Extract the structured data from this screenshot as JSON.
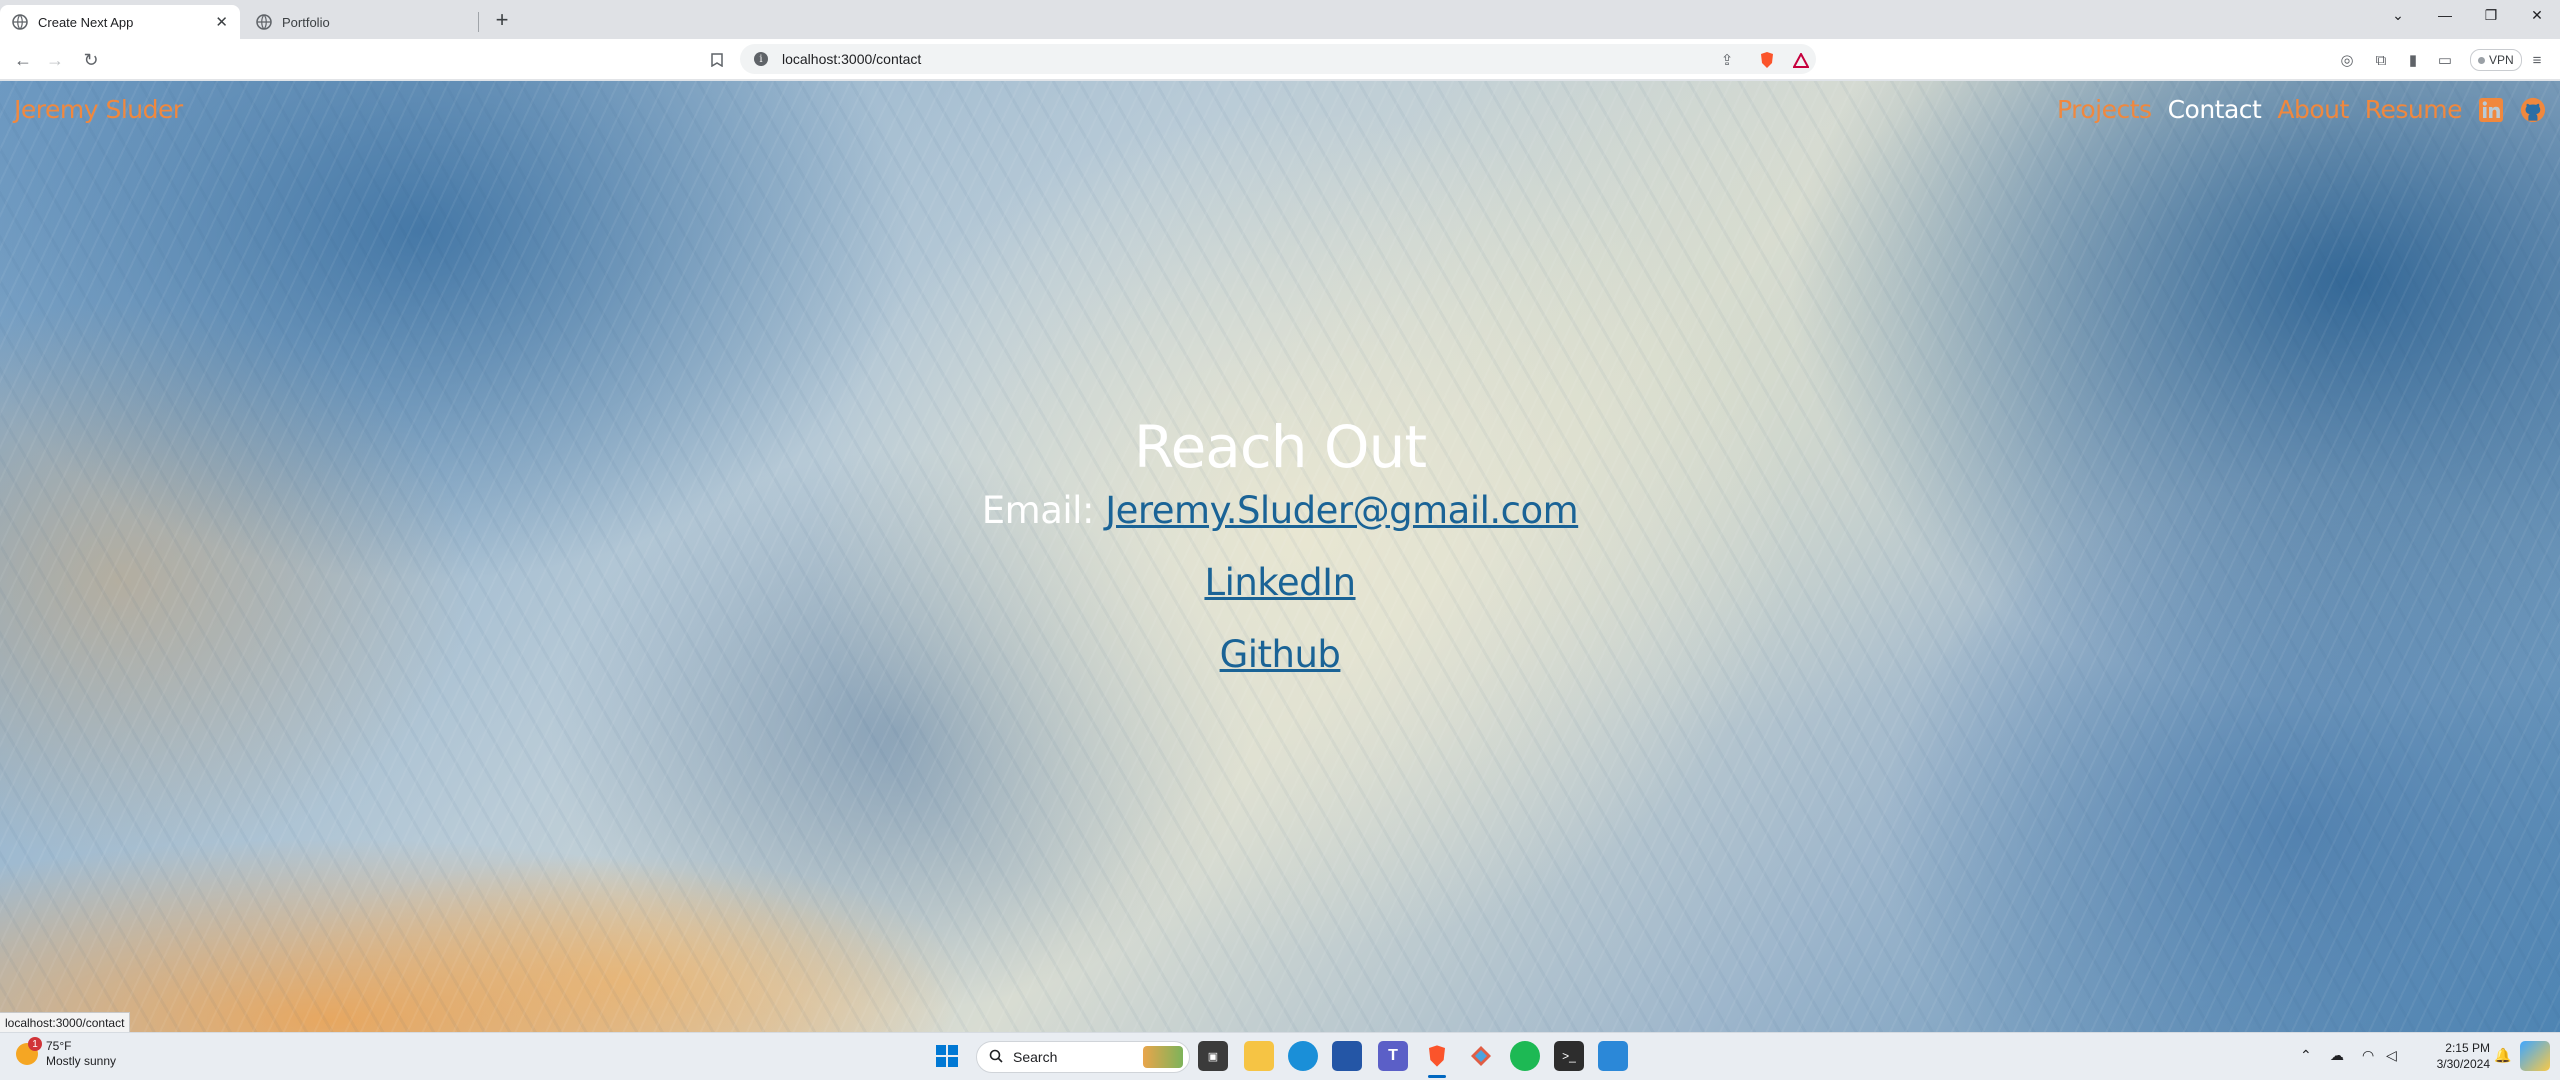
{
  "browser": {
    "tabs": [
      {
        "title": "Create Next App",
        "active": true
      },
      {
        "title": "Portfolio",
        "active": false
      }
    ],
    "url": "localhost:3000/contact",
    "vpn_label": "VPN",
    "status_url": "localhost:3000/contact"
  },
  "site": {
    "brand": "Jeremy Sluder",
    "nav": [
      {
        "label": "Projects"
      },
      {
        "label": "Contact"
      },
      {
        "label": "About"
      },
      {
        "label": "Resume"
      }
    ],
    "social": {
      "linkedin": "in",
      "github": "github"
    }
  },
  "contact": {
    "heading": "Reach Out",
    "email_label": "Email:",
    "email": "Jeremy.Sluder@gmail.com",
    "linkedin": "LinkedIn",
    "github": "Github"
  },
  "taskbar": {
    "weather_temp": "75°F",
    "weather_desc": "Mostly sunny",
    "weather_badge": "1",
    "search_placeholder": "Search",
    "time": "2:15 PM",
    "date": "3/30/2024"
  },
  "colors": {
    "accent_orange": "#f0883e",
    "link_blue": "#1a6396",
    "nav_active": "#ffffff"
  }
}
